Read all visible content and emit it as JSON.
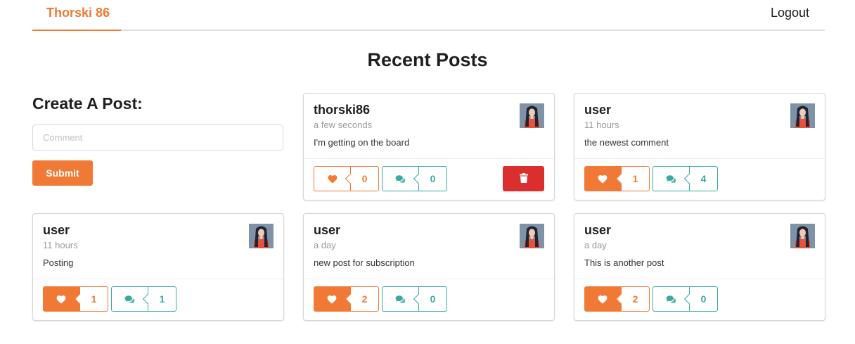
{
  "nav": {
    "brand": "Thorski 86",
    "logout": "Logout"
  },
  "page_title": "Recent Posts",
  "create": {
    "title": "Create A Post:",
    "comment_placeholder": "Comment",
    "comment_value": "",
    "submit_label": "Submit"
  },
  "colors": {
    "accent": "#f07935",
    "teal": "#3aa9a0",
    "danger": "#db2f2f"
  },
  "icons": {
    "like": "heart-icon",
    "comment": "comments-icon",
    "delete": "trash-icon",
    "avatar": "avatar-image"
  },
  "posts": [
    {
      "user": "thorski86",
      "time": "a few seconds",
      "text": "I'm getting on the board",
      "likes": "0",
      "liked": false,
      "comments": "0",
      "deletable": true
    },
    {
      "user": "user",
      "time": "11 hours",
      "text": "the newest comment",
      "likes": "1",
      "liked": true,
      "comments": "4",
      "deletable": false
    },
    {
      "user": "user",
      "time": "11 hours",
      "text": "Posting",
      "likes": "1",
      "liked": true,
      "comments": "1",
      "deletable": false
    },
    {
      "user": "user",
      "time": "a day",
      "text": "new post for subscription",
      "likes": "2",
      "liked": true,
      "comments": "0",
      "deletable": false
    },
    {
      "user": "user",
      "time": "a day",
      "text": "This is another post",
      "likes": "2",
      "liked": true,
      "comments": "0",
      "deletable": false
    }
  ]
}
